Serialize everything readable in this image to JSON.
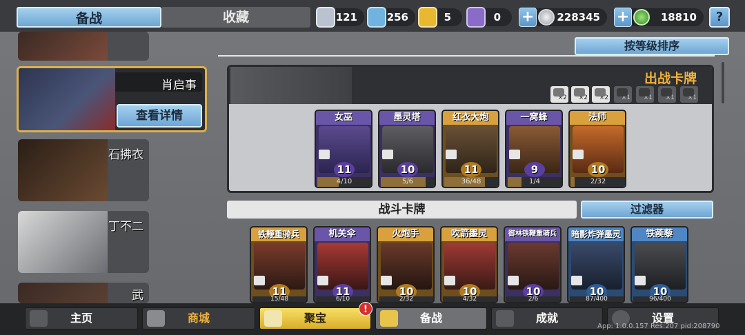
{
  "tabs": {
    "prep": "备战",
    "collection": "收藏"
  },
  "resources": [
    {
      "icon": "silver-shield-icon",
      "value": "121",
      "color": "#b9c3cf"
    },
    {
      "icon": "blue-crystal-icon",
      "value": "256",
      "color": "#6fb4e0"
    },
    {
      "icon": "gold-badge-icon",
      "value": "5",
      "color": "#e8b830"
    },
    {
      "icon": "purple-crystal-icon",
      "value": "0",
      "color": "#8a6cc8"
    }
  ],
  "currency": {
    "silver": {
      "icon": "silver-coin-icon",
      "value": "228345"
    },
    "green": {
      "icon": "green-gem-icon",
      "value": "18810"
    }
  },
  "help_label": "?",
  "heroes": [
    {
      "name": "",
      "color": "#7a4a3a"
    },
    {
      "name": "肖启事",
      "detail_label": "查看详情",
      "color": "#3f4a6a"
    },
    {
      "name": "石拂衣",
      "color": "#5a3f2c"
    },
    {
      "name": "丁不二",
      "color": "#8a8d92"
    },
    {
      "name": "武",
      "color": "#4a3a30"
    }
  ],
  "sort_label": "按等级排序",
  "battle": {
    "title": "出战卡牌",
    "quotas": [
      {
        "icon": "skull-icon",
        "count": "×2",
        "active": true
      },
      {
        "icon": "wall-icon",
        "count": "×2",
        "active": true
      },
      {
        "icon": "burst-icon",
        "count": "×2",
        "active": true
      },
      {
        "icon": "tower-icon",
        "count": "×1",
        "active": false
      },
      {
        "icon": "gate-icon",
        "count": "×1",
        "active": false
      },
      {
        "icon": "gear-icon",
        "count": "×1",
        "active": false
      },
      {
        "icon": "helmet-icon",
        "count": "×1",
        "active": false
      }
    ],
    "cards": [
      {
        "name": "女巫",
        "level": "11",
        "progress": "4/10",
        "fill": 0.4,
        "rarity": "purple",
        "type_icon": "skull-icon"
      },
      {
        "name": "墨灵塔",
        "level": "10",
        "progress": "5/6",
        "fill": 0.83,
        "rarity": "purple",
        "type_icon": "wall-icon"
      },
      {
        "name": "红衣大炮",
        "level": "11",
        "progress": "36/48",
        "fill": 0.75,
        "rarity": "gold",
        "type_icon": "wall-icon"
      },
      {
        "name": "一窝蜂",
        "level": "9",
        "progress": "1/4",
        "fill": 0.25,
        "rarity": "purple",
        "type_icon": "burst-icon"
      },
      {
        "name": "法师",
        "level": "10",
        "progress": "2/32",
        "fill": 0.06,
        "rarity": "gold",
        "type_icon": "skull-icon"
      }
    ]
  },
  "fight_cards_label": "战斗卡牌",
  "filter_label": "过滤器",
  "fight_cards": [
    {
      "name": "铁鞭重骑兵",
      "level": "11",
      "progress": "15/48",
      "rarity": "gold"
    },
    {
      "name": "机关伞",
      "level": "11",
      "progress": "6/10",
      "rarity": "purple"
    },
    {
      "name": "火炮手",
      "level": "10",
      "progress": "2/32",
      "rarity": "gold"
    },
    {
      "name": "吹箭墨灵",
      "level": "10",
      "progress": "4/32",
      "rarity": "gold"
    },
    {
      "name": "御林铁鞭重骑兵",
      "level": "10",
      "progress": "2/6",
      "rarity": "purple"
    },
    {
      "name": "暗影炸弹墨灵",
      "level": "10",
      "progress": "87/400",
      "rarity": "blue"
    },
    {
      "name": "铁蒺藜",
      "level": "10",
      "progress": "96/400",
      "rarity": "blue"
    }
  ],
  "nav": {
    "home": "主页",
    "shop": "商城",
    "treasure": "聚宝",
    "treasure_badge": "!",
    "prep": "备战",
    "achievements": "成就",
    "settings": "设置"
  },
  "app_info": "App: 1.0.0.157 Res:207 pid:208790"
}
